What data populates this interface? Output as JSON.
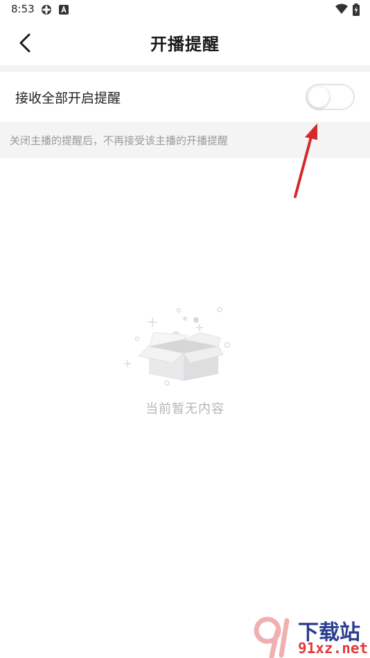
{
  "status_bar": {
    "time": "8:53"
  },
  "header": {
    "title": "开播提醒"
  },
  "setting": {
    "label": "接收全部开启提醒",
    "toggle_on": false
  },
  "hint": {
    "text": "关闭主播的提醒后，不再接受该主播的开播提醒"
  },
  "empty_state": {
    "text": "当前暂无内容"
  },
  "watermark": {
    "line1": "下载站",
    "line2": "91xz.net"
  },
  "colors": {
    "annotation_arrow": "#d42a2a",
    "hint_background": "#f4f4f4",
    "empty_text": "#b5b5b5"
  }
}
